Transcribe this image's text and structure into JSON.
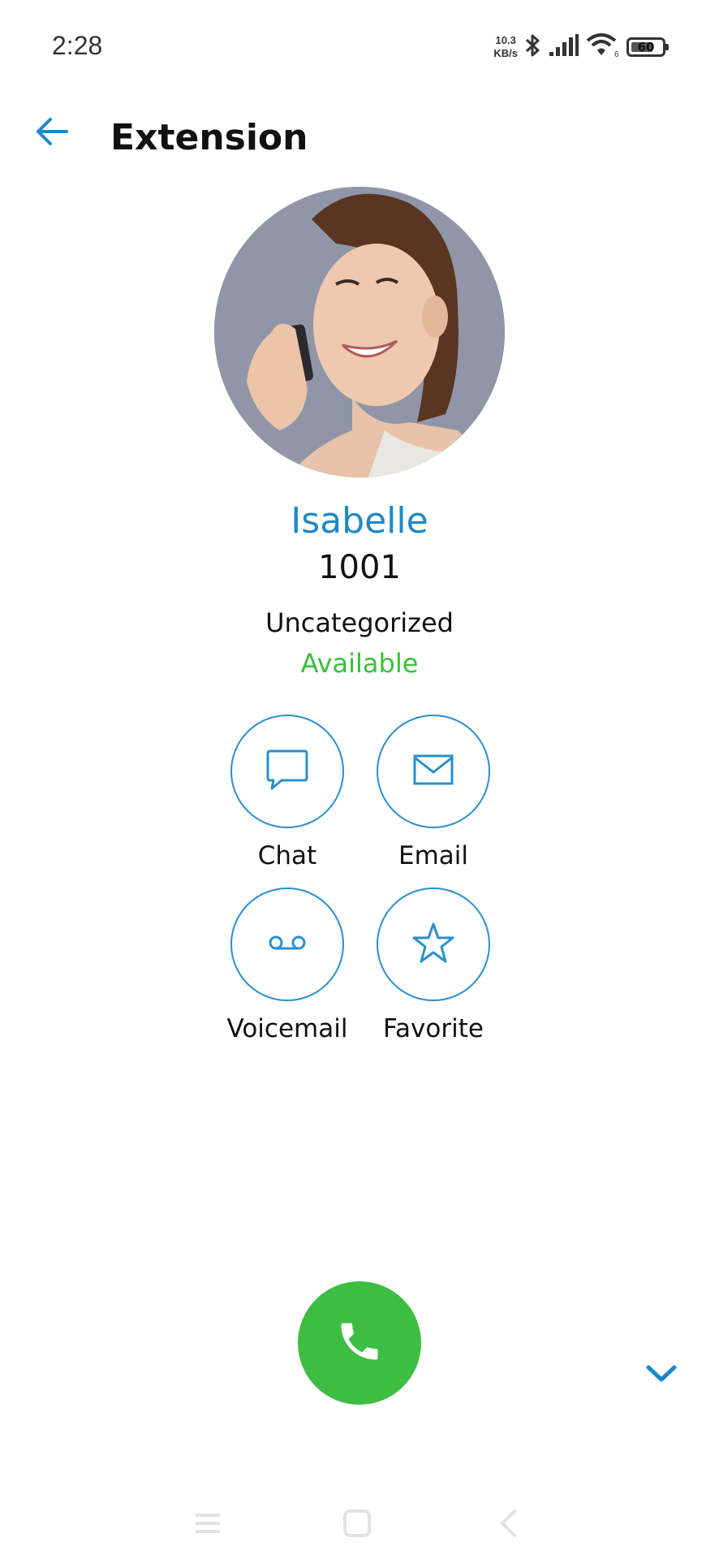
{
  "status_bar": {
    "time": "2:28",
    "net_speed_value": "10.3",
    "net_speed_unit": "KB/s",
    "battery": "60",
    "icons": [
      "bluetooth-icon",
      "signal-icon",
      "wifi-icon",
      "battery-icon"
    ]
  },
  "header": {
    "title": "Extension",
    "back_icon": "arrow-left-icon"
  },
  "contact": {
    "name": "Isabelle",
    "extension": "1001",
    "category": "Uncategorized",
    "status": "Available"
  },
  "actions": [
    {
      "label": "Chat",
      "icon": "chat-bubble-icon"
    },
    {
      "label": "Email",
      "icon": "envelope-icon"
    },
    {
      "label": "Voicemail",
      "icon": "voicemail-icon"
    },
    {
      "label": "Favorite",
      "icon": "star-icon"
    }
  ],
  "call": {
    "icon": "phone-icon"
  },
  "expand": {
    "icon": "chevron-down-icon"
  },
  "colors": {
    "accent": "#1e88c8",
    "available": "#37c13a",
    "call": "#3dbd41"
  }
}
